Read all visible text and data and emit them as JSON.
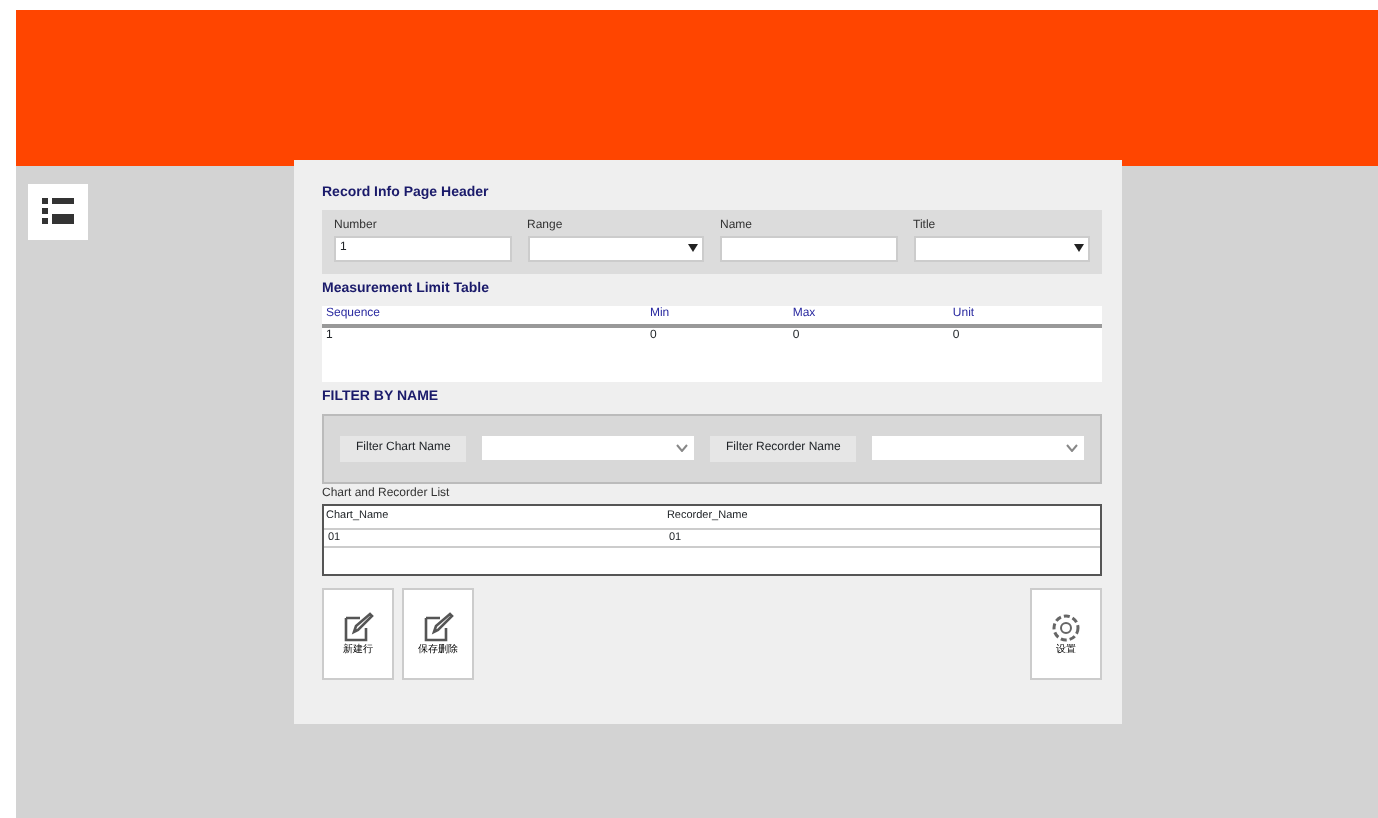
{
  "form_section": {
    "title": "Record Info Page Header",
    "fields": [
      {
        "label": "Number",
        "value": "1",
        "kind": "text"
      },
      {
        "label": "Range",
        "kind": "select"
      },
      {
        "label": "Name",
        "kind": "text"
      },
      {
        "label": "Title",
        "kind": "select"
      }
    ]
  },
  "grid_section": {
    "title": "Measurement Limit Table",
    "columns": [
      "Sequence",
      "Min",
      "Max",
      "Unit"
    ],
    "rows": [
      [
        "1",
        "0",
        "0",
        "0"
      ]
    ]
  },
  "filter_section": {
    "title": "FILTER BY NAME",
    "filters": [
      {
        "label": "Filter Chart Name"
      },
      {
        "label": "Filter Recorder Name"
      }
    ]
  },
  "list_section": {
    "title": "Chart and Recorder List",
    "columns": [
      "Chart_Name",
      "Recorder_Name"
    ],
    "rows": [
      [
        "01",
        "01"
      ]
    ]
  },
  "buttons": [
    {
      "label": "新建行",
      "kind": "edit"
    },
    {
      "label": "保存删除",
      "kind": "edit"
    },
    {
      "label": "设置",
      "kind": "gear"
    }
  ]
}
